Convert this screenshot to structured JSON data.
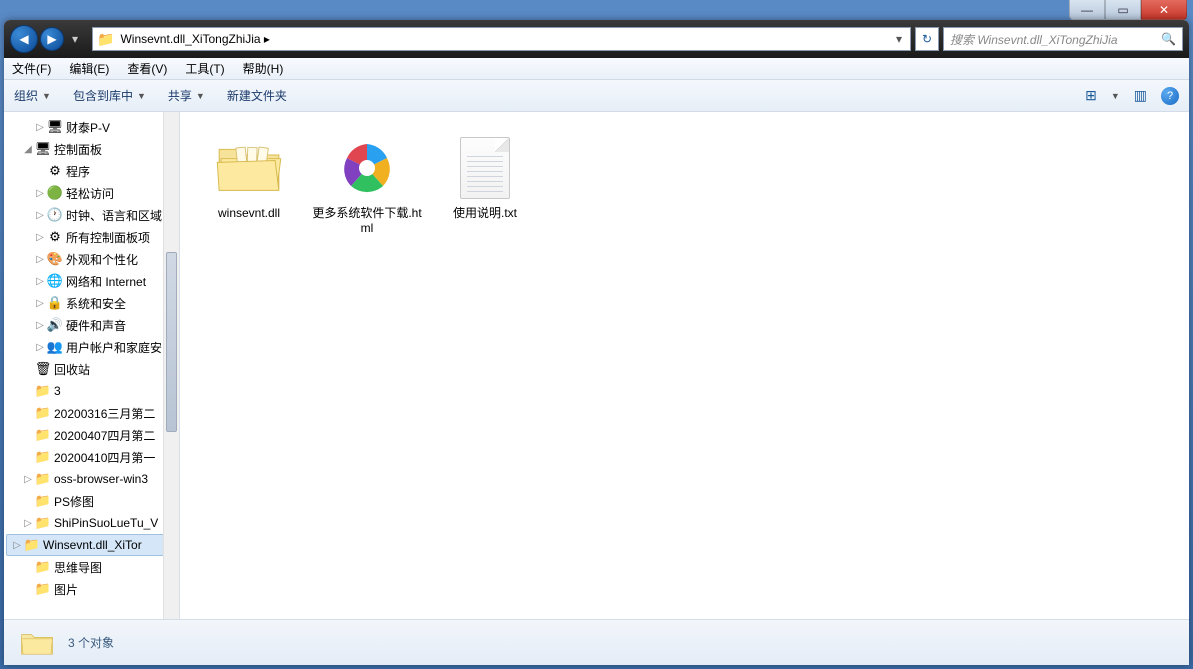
{
  "window_controls": {
    "min": "—",
    "max": "▭",
    "close": "✕"
  },
  "nav": {
    "back": "◀",
    "fwd": "▶",
    "refresh": "↻",
    "drop": "▾",
    "path_icon": "📁",
    "path_text": "Winsevnt.dll_XiTongZhiJia  ▸",
    "search_placeholder": "搜索 Winsevnt.dll_XiTongZhiJia",
    "search_icon": "🔍"
  },
  "menus": [
    {
      "label": "文件(F)"
    },
    {
      "label": "编辑(E)"
    },
    {
      "label": "查看(V)"
    },
    {
      "label": "工具(T)"
    },
    {
      "label": "帮助(H)"
    }
  ],
  "toolbar": {
    "organize": "组织",
    "include": "包含到库中",
    "share": "共享",
    "newfolder": "新建文件夹",
    "view": "⊞",
    "preview": "▥",
    "help": "?"
  },
  "tree": [
    {
      "indent": 2,
      "expander": "▷",
      "icon": "🖥",
      "label": "财泰P-V"
    },
    {
      "indent": 1,
      "expander": "◢",
      "icon": "🖥",
      "label": "控制面板"
    },
    {
      "indent": 2,
      "expander": "",
      "icon": "⚙",
      "label": "程序"
    },
    {
      "indent": 2,
      "expander": "▷",
      "icon": "🟢",
      "label": "轻松访问"
    },
    {
      "indent": 2,
      "expander": "▷",
      "icon": "🕐",
      "label": "时钟、语言和区域"
    },
    {
      "indent": 2,
      "expander": "▷",
      "icon": "⚙",
      "label": "所有控制面板项"
    },
    {
      "indent": 2,
      "expander": "▷",
      "icon": "🎨",
      "label": "外观和个性化"
    },
    {
      "indent": 2,
      "expander": "▷",
      "icon": "🌐",
      "label": "网络和 Internet"
    },
    {
      "indent": 2,
      "expander": "▷",
      "icon": "🔒",
      "label": "系统和安全"
    },
    {
      "indent": 2,
      "expander": "▷",
      "icon": "🔊",
      "label": "硬件和声音"
    },
    {
      "indent": 2,
      "expander": "▷",
      "icon": "👥",
      "label": "用户帐户和家庭安"
    },
    {
      "indent": 1,
      "expander": "",
      "icon": "🗑",
      "label": "回收站"
    },
    {
      "indent": 1,
      "expander": "",
      "icon": "📁",
      "label": "3"
    },
    {
      "indent": 1,
      "expander": "",
      "icon": "📁",
      "label": "20200316三月第二"
    },
    {
      "indent": 1,
      "expander": "",
      "icon": "📁",
      "label": "20200407四月第二"
    },
    {
      "indent": 1,
      "expander": "",
      "icon": "📁",
      "label": "20200410四月第一"
    },
    {
      "indent": 1,
      "expander": "▷",
      "icon": "📁",
      "label": "oss-browser-win3"
    },
    {
      "indent": 1,
      "expander": "",
      "icon": "📁",
      "label": "PS修图"
    },
    {
      "indent": 1,
      "expander": "▷",
      "icon": "📁",
      "label": "ShiPinSuoLueTu_V"
    },
    {
      "indent": 1,
      "expander": "▷",
      "icon": "📁",
      "label": "Winsevnt.dll_XiTor",
      "selected": true
    },
    {
      "indent": 1,
      "expander": "",
      "icon": "📁",
      "label": "思维导图"
    },
    {
      "indent": 1,
      "expander": "",
      "icon": "📁",
      "label": "图片"
    }
  ],
  "files": [
    {
      "type": "folder",
      "label": "winsevnt.dll"
    },
    {
      "type": "html",
      "label": "更多系统软件下载.html"
    },
    {
      "type": "txt",
      "label": "使用说明.txt"
    }
  ],
  "status": {
    "text": "3 个对象"
  }
}
